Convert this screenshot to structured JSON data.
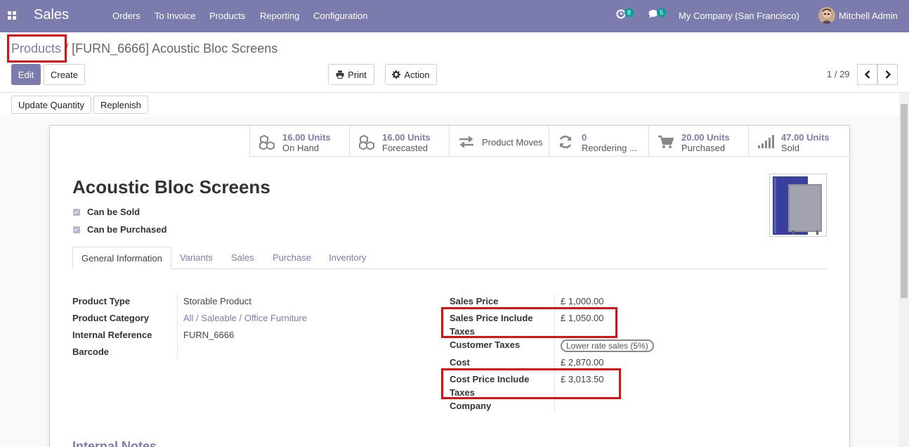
{
  "navbar": {
    "app_name": "Sales",
    "menu": [
      "Orders",
      "To Invoice",
      "Products",
      "Reporting",
      "Configuration"
    ],
    "activity_count": "8",
    "message_count": "5",
    "company": "My Company (San Francisco)",
    "user": "Mitchell Admin"
  },
  "breadcrumb": {
    "parent": "Products",
    "separator": "/",
    "current": "[FURN_6666] Acoustic Bloc Screens"
  },
  "buttons": {
    "edit": "Edit",
    "create": "Create",
    "print": "Print",
    "action": "Action",
    "update_quantity": "Update Quantity",
    "replenish": "Replenish"
  },
  "pager": {
    "text": "1 / 29"
  },
  "stats": [
    {
      "value": "16.00 Units",
      "label": "On Hand",
      "icon": "cubes-icon"
    },
    {
      "value": "16.00 Units",
      "label": "Forecasted",
      "icon": "cubes-icon"
    },
    {
      "value": "",
      "label": "Product Moves",
      "icon": "exchange-icon"
    },
    {
      "value": "0",
      "label": "Reordering ...",
      "icon": "refresh-icon"
    },
    {
      "value": "20.00 Units",
      "label": "Purchased",
      "icon": "cart-icon"
    },
    {
      "value": "47.00 Units",
      "label": "Sold",
      "icon": "signal-icon"
    }
  ],
  "product": {
    "name": "Acoustic Bloc Screens",
    "can_be_sold": "Can be Sold",
    "can_be_purchased": "Can be Purchased"
  },
  "tabs": [
    "General Information",
    "Variants",
    "Sales",
    "Purchase",
    "Inventory"
  ],
  "left_fields": [
    {
      "label": "Product Type",
      "value": "Storable Product"
    },
    {
      "label": "Product Category",
      "value": "All / Saleable / Office Furniture"
    },
    {
      "label": "Internal Reference",
      "value": "FURN_6666"
    },
    {
      "label": "Barcode",
      "value": ""
    }
  ],
  "right_fields": {
    "sales_price_label": "Sales Price",
    "sales_price": "£ 1,000.00",
    "sales_price_incl_label_1": "Sales Price Include",
    "sales_price_incl_label_2": "Taxes",
    "sales_price_incl": "£ 1,050.00",
    "customer_taxes_label": "Customer Taxes",
    "customer_taxes": "Lower rate sales (5%)",
    "cost_label": "Cost",
    "cost": "£ 2,870.00",
    "cost_incl_label_1": "Cost Price Include",
    "cost_incl_label_2": "Taxes",
    "cost_incl": "£ 3,013.50",
    "company_label": "Company",
    "company": ""
  },
  "internal_notes_title": "Internal Notes"
}
